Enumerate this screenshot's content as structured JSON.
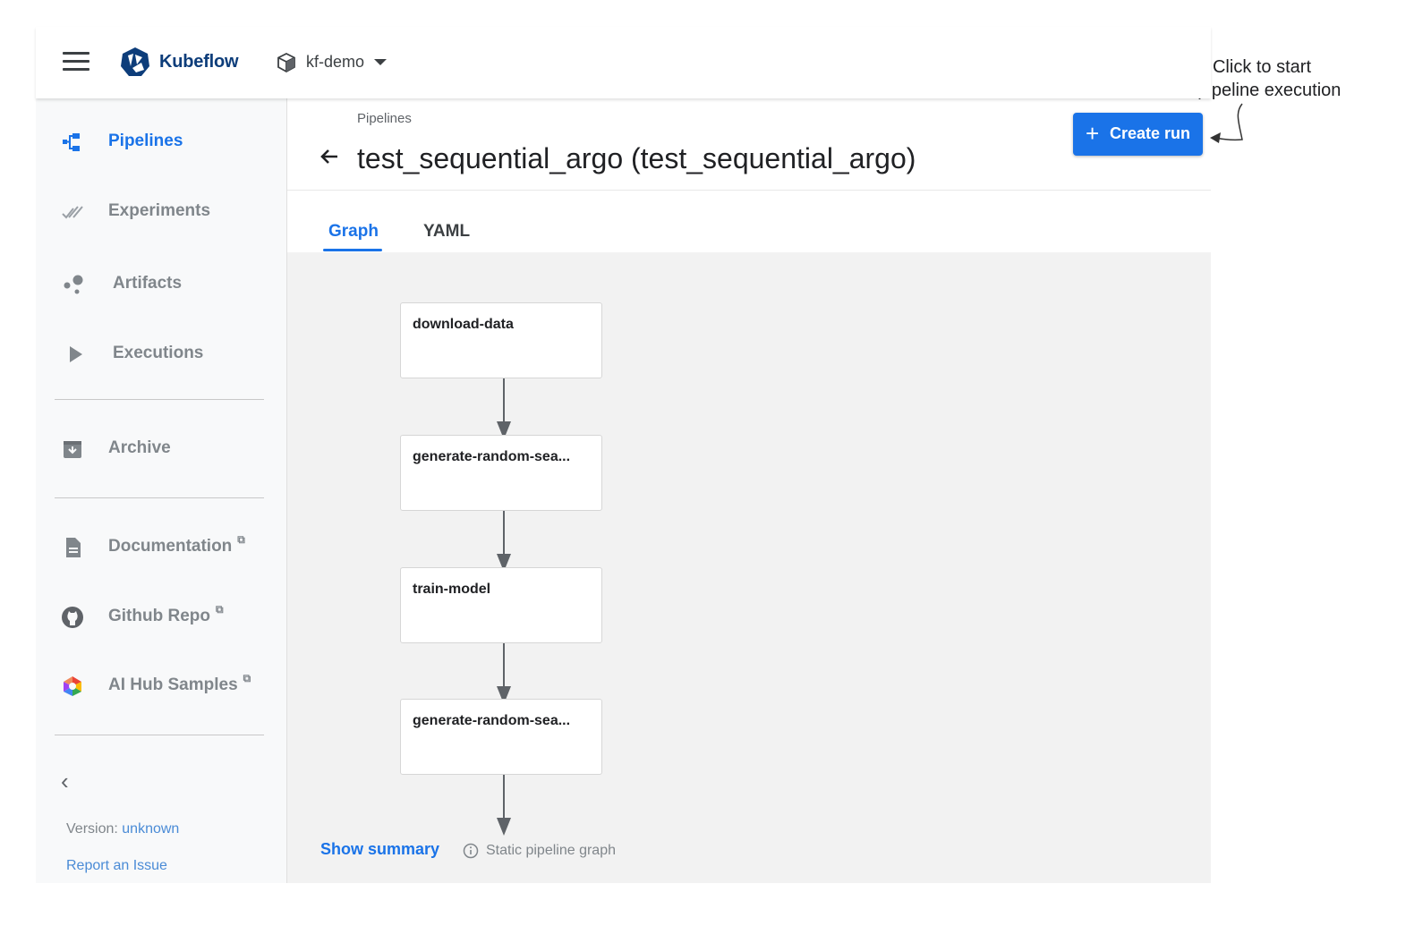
{
  "topbar": {
    "logo_text": "Kubeflow",
    "namespace": "kf-demo"
  },
  "sidebar": {
    "items": [
      {
        "label": "Pipelines",
        "icon": "pipelines-icon",
        "active": true
      },
      {
        "label": "Experiments",
        "icon": "experiments-icon"
      },
      {
        "label": "Artifacts",
        "icon": "artifacts-icon"
      },
      {
        "label": "Executions",
        "icon": "executions-icon"
      },
      {
        "label": "Archive",
        "icon": "archive-icon"
      },
      {
        "label": "Documentation",
        "icon": "document-icon",
        "external": true
      },
      {
        "label": "Github Repo",
        "icon": "github-icon",
        "external": true
      },
      {
        "label": "AI Hub Samples",
        "icon": "ai-hub-icon",
        "external": true
      }
    ],
    "version_label": "Version:",
    "version_value": "unknown",
    "report_issue": "Report an Issue"
  },
  "header": {
    "breadcrumb": "Pipelines",
    "title": "test_sequential_argo (test_sequential_argo)",
    "create_run_label": "Create run"
  },
  "tabs": [
    {
      "label": "Graph",
      "active": true
    },
    {
      "label": "YAML"
    }
  ],
  "graph": {
    "nodes": [
      "download-data",
      "generate-random-sea...",
      "train-model",
      "generate-random-sea..."
    ],
    "show_summary": "Show summary",
    "static_note": "Static pipeline graph"
  },
  "annotation": {
    "line1": "Click to start",
    "line2": "a pipeline execution"
  },
  "colors": {
    "accent": "#1a73e8",
    "brand": "#0d3d7a",
    "graph_bg": "#f2f2f2"
  }
}
